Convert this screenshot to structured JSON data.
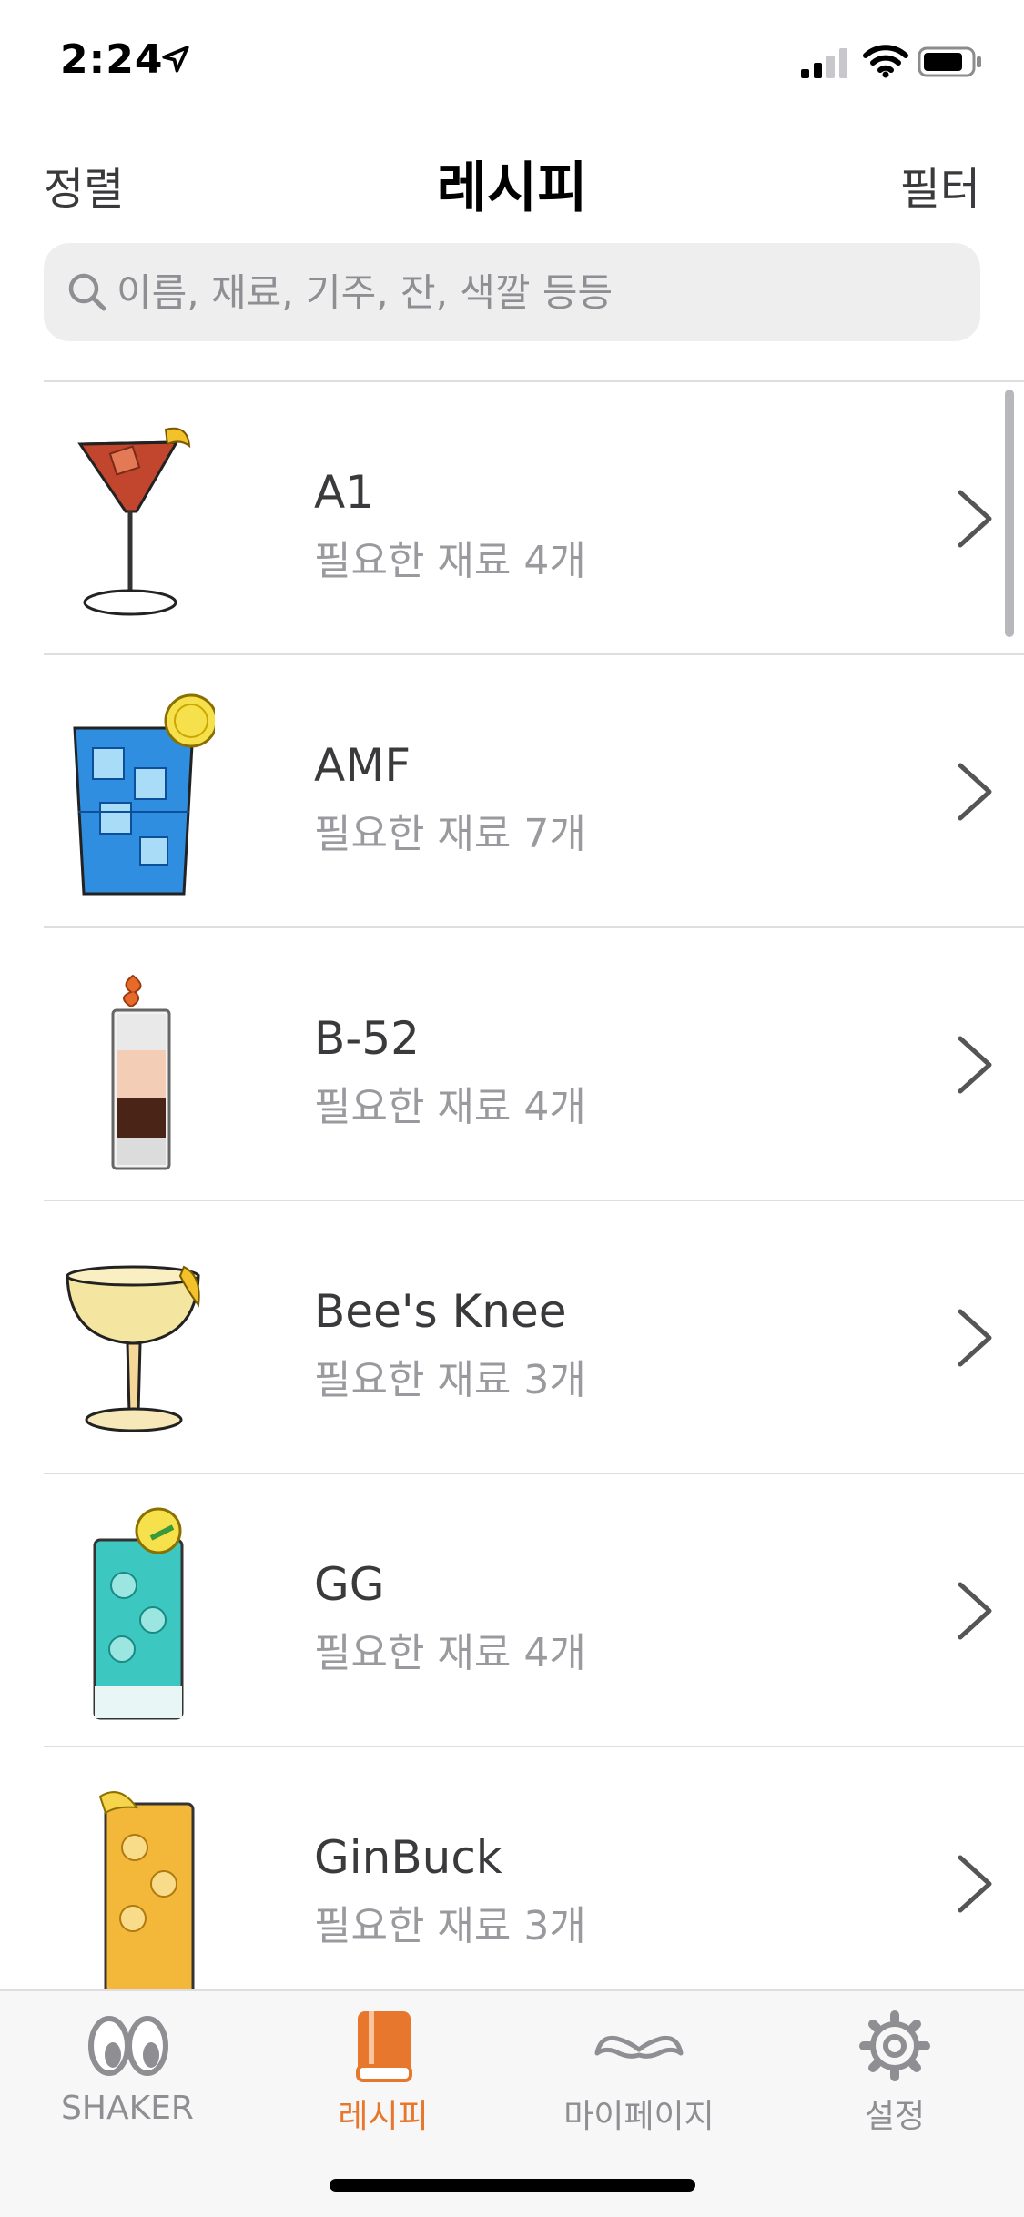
{
  "status_bar": {
    "time": "2:24",
    "location_icon": "location-arrow-icon",
    "signal_icon": "cellular-signal-icon",
    "wifi_icon": "wifi-icon",
    "battery_icon": "battery-icon"
  },
  "nav": {
    "left_label": "정렬",
    "title": "레시피",
    "right_label": "필터"
  },
  "search": {
    "placeholder": "이름, 재료, 기주, 잔, 색깔 등등",
    "value": "",
    "icon": "search-icon"
  },
  "recipes": [
    {
      "name": "A1",
      "subtitle": "필요한 재료 4개",
      "icon": "martini-glass-icon"
    },
    {
      "name": "AMF",
      "subtitle": "필요한 재료 7개",
      "icon": "blue-highball-glass-icon"
    },
    {
      "name": "B-52",
      "subtitle": "필요한 재료 4개",
      "icon": "layered-shot-glass-icon"
    },
    {
      "name": "Bee's Knee",
      "subtitle": "필요한 재료 3개",
      "icon": "coupe-glass-icon"
    },
    {
      "name": "GG",
      "subtitle": "필요한 재료 4개",
      "icon": "teal-collins-glass-icon"
    },
    {
      "name": "GinBuck",
      "subtitle": "필요한 재료 3개",
      "icon": "golden-collins-glass-icon"
    }
  ],
  "tabs": [
    {
      "label": "SHAKER",
      "icon": "eyes-icon",
      "active": false
    },
    {
      "label": "레시피",
      "icon": "book-icon",
      "active": true
    },
    {
      "label": "마이페이지",
      "icon": "mustache-icon",
      "active": false
    },
    {
      "label": "설정",
      "icon": "gear-icon",
      "active": false
    }
  ],
  "colors": {
    "accent": "#e8772e",
    "inactive": "#8e8e93",
    "divider": "#dedee0"
  }
}
